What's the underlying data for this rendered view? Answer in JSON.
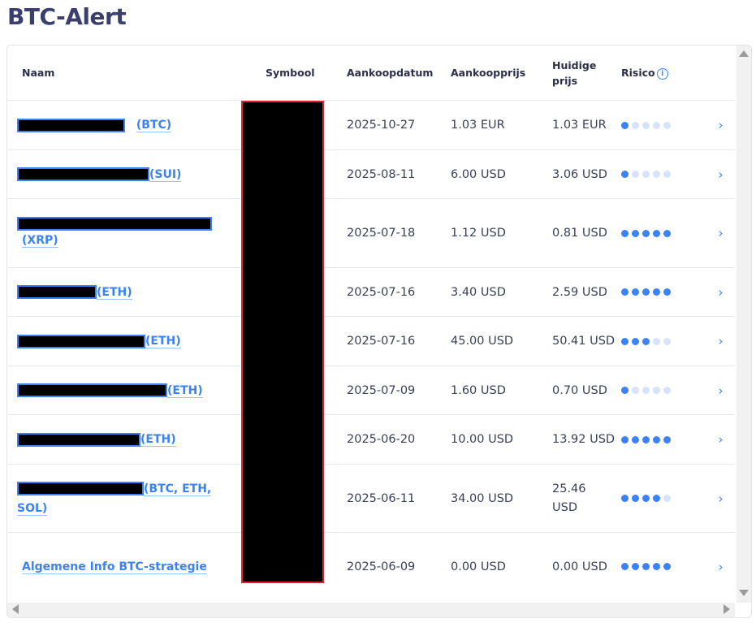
{
  "page_title": "BTC-Alert",
  "headers": {
    "name": "Naam",
    "symbol": "Symbool",
    "date": "Aankoopdatum",
    "buy_price": "Aankoopprijs",
    "current_price": "Huidige prijs",
    "risk": "Risico"
  },
  "rows": [
    {
      "name_suffix": "(BTC)",
      "date": "2025-10-27",
      "buy": "1.03 EUR",
      "current": "1.03 EUR",
      "risk": 1
    },
    {
      "name_suffix": "(SUI)",
      "date": "2025-08-11",
      "buy": "6.00 USD",
      "current": "3.06 USD",
      "risk": 1
    },
    {
      "name_suffix": "(XRP)",
      "date": "2025-07-18",
      "buy": "1.12 USD",
      "current": "0.81 USD",
      "risk": 5
    },
    {
      "name_suffix": "(ETH)",
      "date": "2025-07-16",
      "buy": "3.40 USD",
      "current": "2.59 USD",
      "risk": 5
    },
    {
      "name_suffix": "(ETH)",
      "date": "2025-07-16",
      "buy": "45.00 USD",
      "current": "50.41 USD",
      "risk": 3
    },
    {
      "name_suffix": "(ETH)",
      "date": "2025-07-09",
      "buy": "1.60 USD",
      "current": "0.70 USD",
      "risk": 1
    },
    {
      "name_suffix": "(ETH)",
      "date": "2025-06-20",
      "buy": "10.00 USD",
      "current": "13.92 USD",
      "risk": 5
    },
    {
      "name_suffix": "(BTC, ETH, SOL)",
      "date": "2025-06-11",
      "buy": "34.00 USD",
      "current": "25.46 USD",
      "risk": 4
    },
    {
      "name": "Algemene Info BTC-strategie",
      "date": "2025-06-09",
      "buy": "0.00 USD",
      "current": "0.00 USD",
      "risk": 5
    }
  ],
  "icons": {
    "info": "info-icon",
    "row_action": "chevron-right-icon"
  },
  "colors": {
    "accent": "#3b82f6",
    "title": "#3a3f6e",
    "redaction_border": "#e0242f"
  }
}
